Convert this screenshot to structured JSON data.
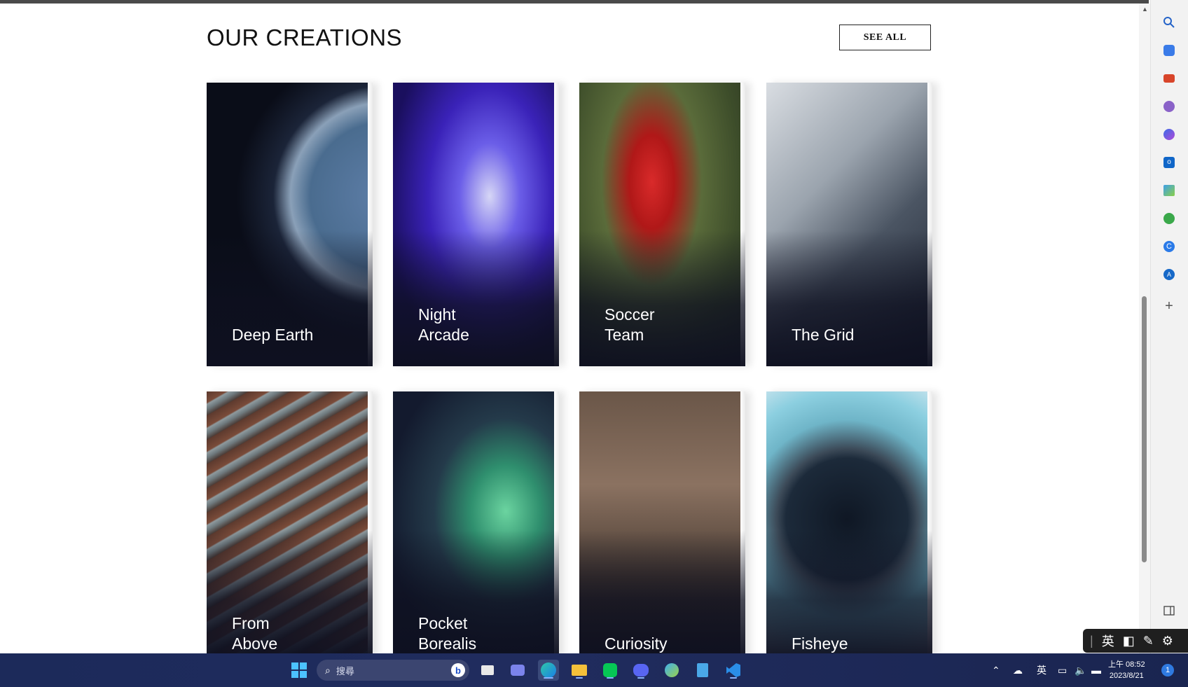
{
  "section": {
    "title": "OUR CREATIONS",
    "see_all": "SEE ALL"
  },
  "cards": [
    {
      "label": "Deep Earth",
      "image": "earth-from-space"
    },
    {
      "label": "Night Arcade",
      "image": "arcade-skeeball"
    },
    {
      "label": "Soccer Team",
      "image": "soccer-player"
    },
    {
      "label": "The Grid",
      "image": "race-car"
    },
    {
      "label": "From Above",
      "image": "aerial-winding-road"
    },
    {
      "label": "Pocket Borealis",
      "image": "aurora-borealis"
    },
    {
      "label": "Curiosity",
      "image": "mars-rover"
    },
    {
      "label": "Fisheye",
      "image": "fisheye-planet"
    }
  ],
  "sidebar_icons": [
    "search-icon",
    "tag-icon",
    "toolbox-icon",
    "chess-icon",
    "copilot-icon",
    "outlook-icon",
    "send-icon",
    "tree-icon",
    "c-app-icon",
    "a-app-icon",
    "add-icon",
    "sidebar-toggle-icon"
  ],
  "ime": {
    "lang": "英"
  },
  "taskbar": {
    "search_placeholder": "搜尋",
    "tray_lang": "英",
    "time": "上午 08:52",
    "date": "2023/8/21",
    "notification_count": "1"
  }
}
